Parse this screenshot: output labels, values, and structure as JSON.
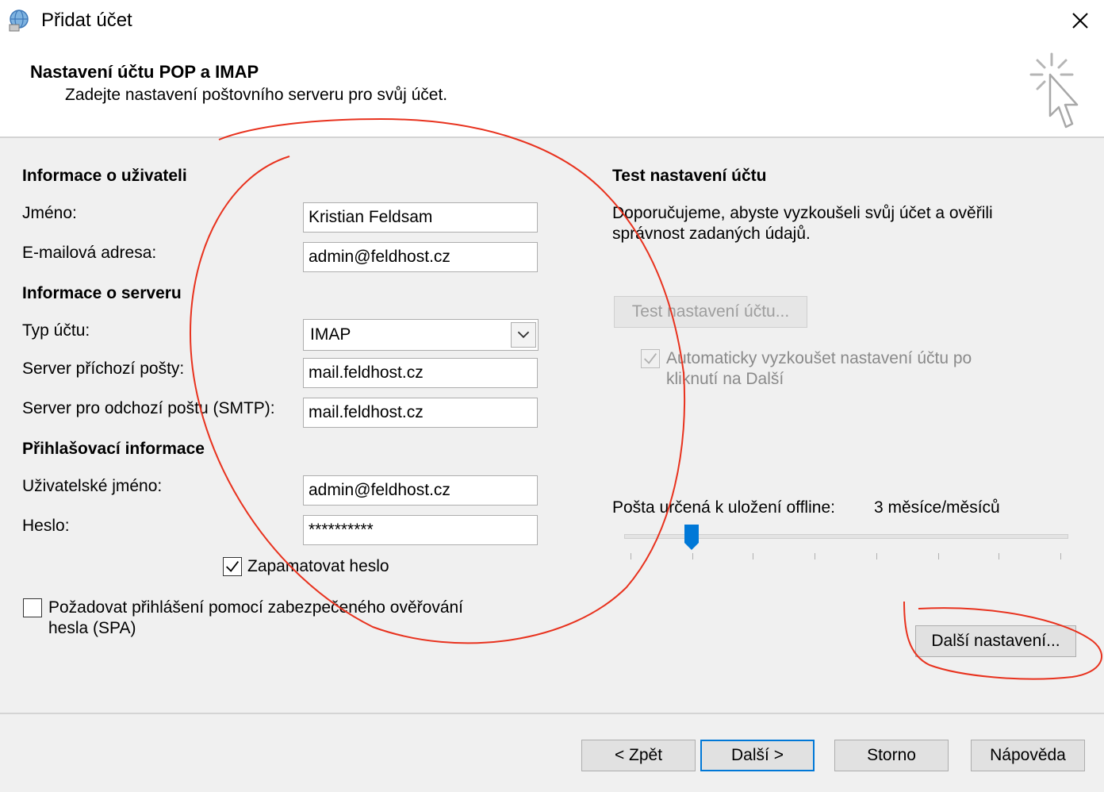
{
  "window": {
    "title": "Přidat účet",
    "close_icon": "close-icon"
  },
  "header": {
    "title": "Nastavení účtu POP a IMAP",
    "subtitle": "Zadejte nastavení poštovního serveru pro svůj účet."
  },
  "user_info": {
    "heading": "Informace o uživateli",
    "name_label": "Jméno:",
    "name_value": "Kristian Feldsam",
    "email_label": "E-mailová adresa:",
    "email_value": "admin@feldhost.cz"
  },
  "server_info": {
    "heading": "Informace o serveru",
    "account_type_label": "Typ účtu:",
    "account_type_value": "IMAP",
    "incoming_label": "Server příchozí pošty:",
    "incoming_value": "mail.feldhost.cz",
    "outgoing_label": "Server pro odchozí poštu (SMTP):",
    "outgoing_value": "mail.feldhost.cz"
  },
  "login_info": {
    "heading": "Přihlašovací informace",
    "username_label": "Uživatelské jméno:",
    "username_value": "admin@feldhost.cz",
    "password_label": "Heslo:",
    "password_value": "**********",
    "remember_label": "Zapamatovat heslo",
    "remember_checked": true,
    "spa_label_line1": "Požadovat přihlášení pomocí zabezpečeného ověřování",
    "spa_label_line2": "hesla (SPA)",
    "spa_checked": false
  },
  "test_settings": {
    "heading": "Test nastavení účtu",
    "desc_line1": "Doporučujeme, abyste vyzkoušeli svůj účet a ověřili",
    "desc_line2": "správnost zadaných údajů.",
    "test_button": "Test nastavení účtu...",
    "auto_test_line1": "Automaticky vyzkoušet nastavení účtu po",
    "auto_test_line2": "kliknutí na Další",
    "auto_test_checked": true
  },
  "offline": {
    "label": "Pošta určená k uložení offline:",
    "value": "3 měsíce/měsíců",
    "slider_position": 0.14
  },
  "more_settings_button": "Další nastavení...",
  "footer": {
    "back": "< Zpět",
    "next": "Další >",
    "cancel": "Storno",
    "help": "Nápověda"
  },
  "colors": {
    "accent": "#0078d7",
    "annotation": "#e8321e"
  }
}
